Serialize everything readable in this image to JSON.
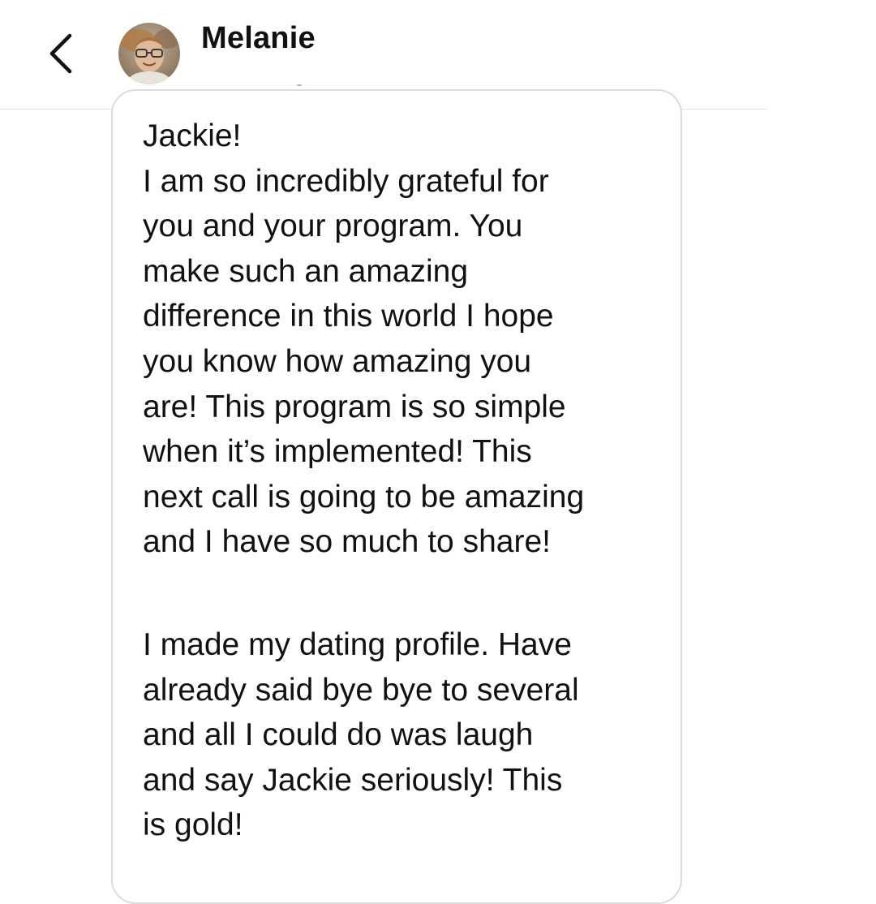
{
  "header": {
    "contact_name": "Melanie",
    "back_icon": "chevron-left-icon",
    "avatar_icon": "profile-photo"
  },
  "message": {
    "paragraphs": [
      {
        "lines": [
          "Jackie!",
          "I am so incredibly grateful for",
          "you and your program. You",
          "make such an amazing",
          "difference in this world I hope",
          "you know how amazing you",
          "are! This program is so simple",
          "when it’s implemented! This",
          "next call is going to be amazing",
          "and I have so much to share!"
        ]
      },
      {
        "lines": [
          "I made my dating profile. Have",
          "already said bye bye to several",
          "and all I could do was laugh",
          "and say Jackie seriously! This",
          "is gold!"
        ]
      }
    ]
  },
  "colors": {
    "text": "#111111",
    "bubble_border": "#dcdcdc",
    "divider": "#e4e4e4",
    "background": "#ffffff"
  }
}
